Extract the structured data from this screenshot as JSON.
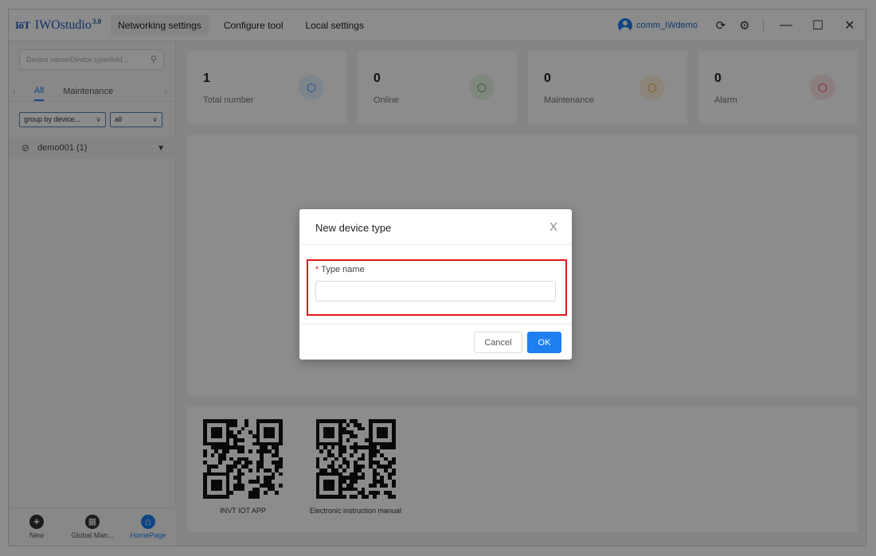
{
  "app": {
    "logo_prefix": "IōT",
    "name": "IWOstudio",
    "version": "3.0"
  },
  "menu": [
    {
      "label": "Networking settings",
      "active": true
    },
    {
      "label": "Configure tool",
      "active": false
    },
    {
      "label": "Local settings",
      "active": false
    }
  ],
  "user": {
    "name": "comm_IWdemo"
  },
  "window_controls": {
    "minimize": "—",
    "maximize": "☐",
    "close": "✕"
  },
  "sidebar": {
    "search_placeholder": "Device name/Device type/Add...",
    "tabs": [
      {
        "label": "All",
        "active": true
      },
      {
        "label": "Maintenance",
        "active": false
      }
    ],
    "filters": [
      {
        "label": "group by device..."
      },
      {
        "label": "all"
      }
    ],
    "tree": [
      {
        "label": "demo001 (1)"
      }
    ],
    "bottom_nav": [
      {
        "label": "New",
        "icon": "plus-circle-icon",
        "glyph": "+"
      },
      {
        "label": "Global Man...",
        "icon": "grid-circle-icon",
        "glyph": "▦"
      },
      {
        "label": "HomePage",
        "icon": "home-icon",
        "glyph": "⌂",
        "active": true
      }
    ]
  },
  "stats": [
    {
      "value": "1",
      "label": "Total number",
      "icon": "device-icon",
      "color": "#1e7ff0",
      "bg": "#e6f0fd"
    },
    {
      "value": "0",
      "label": "Online",
      "icon": "online-icon",
      "color": "#3aa53a",
      "bg": "#e8f6e8"
    },
    {
      "value": "0",
      "label": "Maintenance",
      "icon": "maintenance-icon",
      "color": "#f0a020",
      "bg": "#fdf3e0"
    },
    {
      "value": "0",
      "label": "Alarm",
      "icon": "alarm-icon",
      "color": "#e84545",
      "bg": "#fde6e6"
    }
  ],
  "qr_codes": [
    {
      "caption": "INVT IOT APP"
    },
    {
      "caption": "Electronic instruction manual"
    }
  ],
  "modal": {
    "title": "New device type",
    "close": "X",
    "field_label": "Type name",
    "required_mark": "*",
    "field_value": "",
    "cancel_label": "Cancel",
    "ok_label": "OK"
  }
}
